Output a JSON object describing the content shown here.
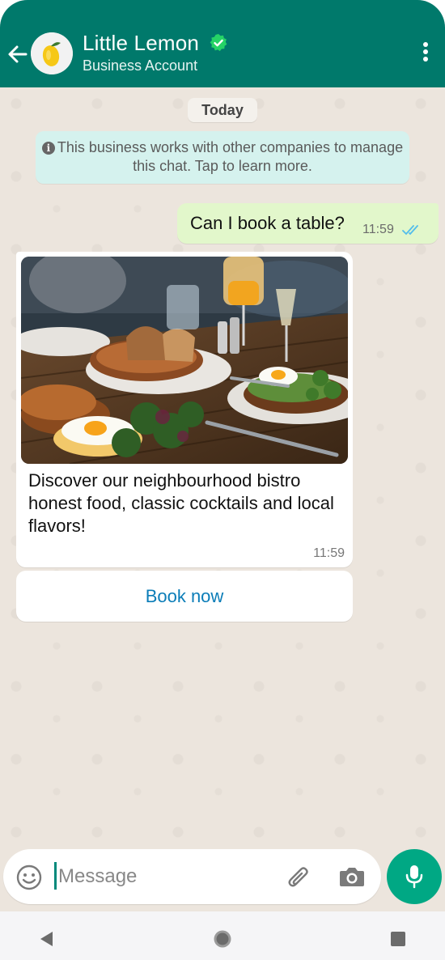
{
  "header": {
    "title": "Little Lemon",
    "subtitle": "Business Account",
    "icons": {
      "back": "back-arrow-icon",
      "avatar": "lemon-logo",
      "verified": "verified-badge-icon",
      "menu": "more-vert-icon"
    },
    "colors": {
      "bar": "#00796B",
      "verified": "#25D366"
    }
  },
  "chat": {
    "date_label": "Today",
    "notice": "This business works with other companies to manage this chat. Tap to learn more.",
    "messages": [
      {
        "direction": "outgoing",
        "text": "Can I book a table?",
        "time": "11:59",
        "status": "read"
      }
    ],
    "card": {
      "caption": "Discover our neighbourhood bistro honest food, classic cocktails and local flavors!",
      "time": "11:59",
      "image_description": "restaurant food photo",
      "button_label": "Book now"
    }
  },
  "composer": {
    "placeholder": "Message",
    "value": "",
    "icons": [
      "emoji-icon",
      "paperclip-icon",
      "camera-icon",
      "mic-icon"
    ],
    "accent": "#00A884"
  },
  "navbar": {
    "icons": [
      "nav-back-icon",
      "nav-home-icon",
      "nav-recents-icon"
    ]
  }
}
